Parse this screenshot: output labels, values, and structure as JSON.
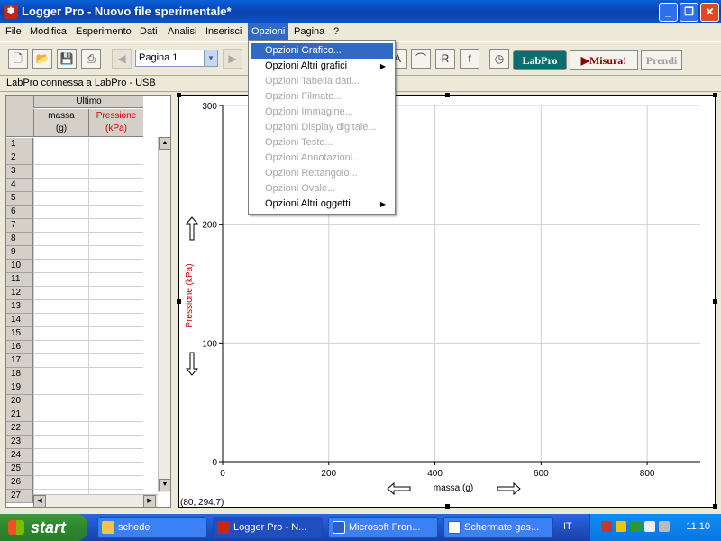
{
  "window": {
    "title": "Logger Pro - Nuovo file sperimentale*"
  },
  "menu": [
    "File",
    "Modifica",
    "Esperimento",
    "Dati",
    "Analisi",
    "Inserisci",
    "Opzioni",
    "Pagina",
    "?"
  ],
  "toolbar": {
    "page_select": "Pagina 1",
    "labpro_label": "LabPro",
    "measure_label": "Misura!",
    "prendi_label": "Prendi"
  },
  "status": {
    "connection": "LabPro connessa a LabPro - USB"
  },
  "table": {
    "group_header": "Ultimo",
    "columns": [
      {
        "name": "massa",
        "unit": "(g)",
        "color": "#000000"
      },
      {
        "name": "Pressione",
        "unit": "(kPa)",
        "color": "#cc0000"
      }
    ],
    "rows": [
      "1",
      "2",
      "3",
      "4",
      "5",
      "6",
      "7",
      "8",
      "9",
      "10",
      "11",
      "12",
      "13",
      "14",
      "15",
      "16",
      "17",
      "18",
      "19",
      "20",
      "21",
      "22",
      "23",
      "24",
      "25",
      "26",
      "27"
    ]
  },
  "dropdown": {
    "items": [
      {
        "label": "Opzioni Grafico...",
        "enabled": true,
        "selected": true,
        "submenu": false
      },
      {
        "label": "Opzioni Altri grafici",
        "enabled": true,
        "selected": false,
        "submenu": true
      },
      {
        "label": "Opzioni Tabella dati...",
        "enabled": false,
        "selected": false,
        "submenu": false
      },
      {
        "label": "Opzioni Filmato...",
        "enabled": false,
        "selected": false,
        "submenu": false
      },
      {
        "label": "Opzioni Immagine...",
        "enabled": false,
        "selected": false,
        "submenu": false
      },
      {
        "label": "Opzioni Display digitale...",
        "enabled": false,
        "selected": false,
        "submenu": false
      },
      {
        "label": "Opzioni Testo...",
        "enabled": false,
        "selected": false,
        "submenu": false
      },
      {
        "label": "Opzioni Annotazioni...",
        "enabled": false,
        "selected": false,
        "submenu": false
      },
      {
        "label": "Opzioni Rettangolo...",
        "enabled": false,
        "selected": false,
        "submenu": false
      },
      {
        "label": "Opzioni Ovale...",
        "enabled": false,
        "selected": false,
        "submenu": false
      },
      {
        "label": "Opzioni Altri oggetti",
        "enabled": true,
        "selected": false,
        "submenu": true
      }
    ]
  },
  "chart_data": {
    "type": "scatter",
    "title": "",
    "xlabel": "massa (g)",
    "ylabel": "Pressione (kPa)",
    "xlim": [
      0,
      900
    ],
    "ylim": [
      0,
      300
    ],
    "x_ticks": [
      0,
      200,
      400,
      600,
      800
    ],
    "y_ticks": [
      0,
      100,
      200,
      300
    ],
    "grid": true,
    "series": []
  },
  "graph": {
    "coordinate_readout": "(80, 294.7)"
  },
  "taskbar": {
    "start_label": "start",
    "tasks": [
      {
        "label": "schede",
        "active": false
      },
      {
        "label": "Logger Pro - N...",
        "active": true
      },
      {
        "label": "Microsoft Fron...",
        "active": false
      },
      {
        "label": "Schermate gas...",
        "active": false
      }
    ],
    "language": "IT",
    "clock": "11.10"
  },
  "colors": {
    "title_blue": "#0842b0",
    "menu_highlight": "#316ac5",
    "pressure_red": "#cc0000",
    "grid": "#d0d0d0"
  }
}
